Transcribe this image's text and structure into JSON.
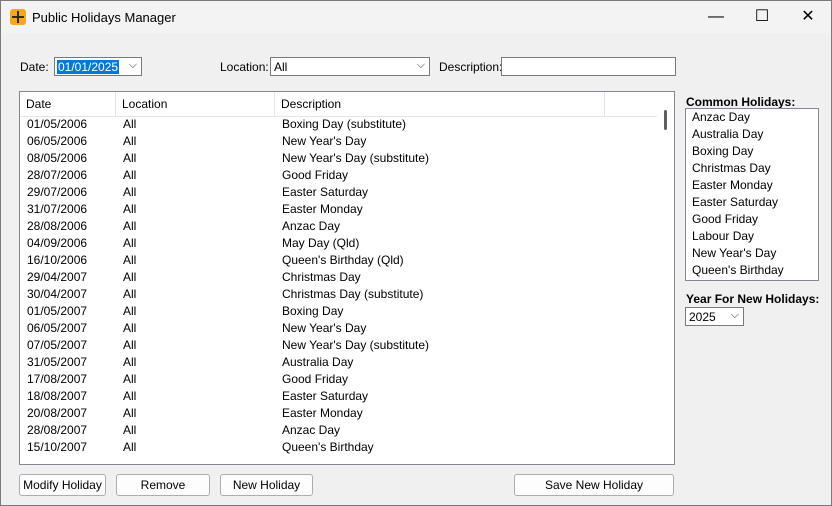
{
  "window": {
    "title": "Public Holidays Manager",
    "minimize_glyph": "—",
    "maximize_glyph": "☐",
    "close_glyph": "✕"
  },
  "filters": {
    "date_label": "Date:",
    "date_value": "01/01/2025",
    "location_label": "Location:",
    "location_value": "All",
    "description_label": "Description:",
    "description_value": ""
  },
  "table": {
    "columns": [
      "Date",
      "Location",
      "Description"
    ],
    "rows": [
      {
        "date": "01/05/2006",
        "location": "All",
        "description": "Boxing Day (substitute)"
      },
      {
        "date": "06/05/2006",
        "location": "All",
        "description": "New Year's Day"
      },
      {
        "date": "08/05/2006",
        "location": "All",
        "description": "New Year's Day (substitute)"
      },
      {
        "date": "28/07/2006",
        "location": "All",
        "description": "Good Friday"
      },
      {
        "date": "29/07/2006",
        "location": "All",
        "description": "Easter Saturday"
      },
      {
        "date": "31/07/2006",
        "location": "All",
        "description": "Easter Monday"
      },
      {
        "date": "28/08/2006",
        "location": "All",
        "description": "Anzac Day"
      },
      {
        "date": "04/09/2006",
        "location": "All",
        "description": "May Day (Qld)"
      },
      {
        "date": "16/10/2006",
        "location": "All",
        "description": "Queen's Birthday (Qld)"
      },
      {
        "date": "29/04/2007",
        "location": "All",
        "description": "Christmas Day"
      },
      {
        "date": "30/04/2007",
        "location": "All",
        "description": "Christmas Day (substitute)"
      },
      {
        "date": "01/05/2007",
        "location": "All",
        "description": "Boxing Day"
      },
      {
        "date": "06/05/2007",
        "location": "All",
        "description": "New Year's Day"
      },
      {
        "date": "07/05/2007",
        "location": "All",
        "description": "New Year's Day (substitute)"
      },
      {
        "date": "31/05/2007",
        "location": "All",
        "description": "Australia Day"
      },
      {
        "date": "17/08/2007",
        "location": "All",
        "description": "Good Friday"
      },
      {
        "date": "18/08/2007",
        "location": "All",
        "description": "Easter Saturday"
      },
      {
        "date": "20/08/2007",
        "location": "All",
        "description": "Easter Monday"
      },
      {
        "date": "28/08/2007",
        "location": "All",
        "description": "Anzac Day"
      },
      {
        "date": "15/10/2007",
        "location": "All",
        "description": "Queen's Birthday"
      }
    ]
  },
  "buttons": {
    "modify": "Modify Holiday",
    "remove": "Remove",
    "new": "New Holiday",
    "save": "Save New Holiday"
  },
  "common_holidays": {
    "label": "Common Holidays:",
    "items": [
      "Anzac Day",
      "Australia Day",
      "Boxing Day",
      "Christmas Day",
      "Easter Monday",
      "Easter Saturday",
      "Good Friday",
      "Labour Day",
      "New Year's Day",
      "Queen's Birthday"
    ]
  },
  "year": {
    "label": "Year For New Holidays:",
    "value": "2025"
  },
  "icons": {
    "dropdown": "chevron-down-icon",
    "app": "app-icon"
  }
}
